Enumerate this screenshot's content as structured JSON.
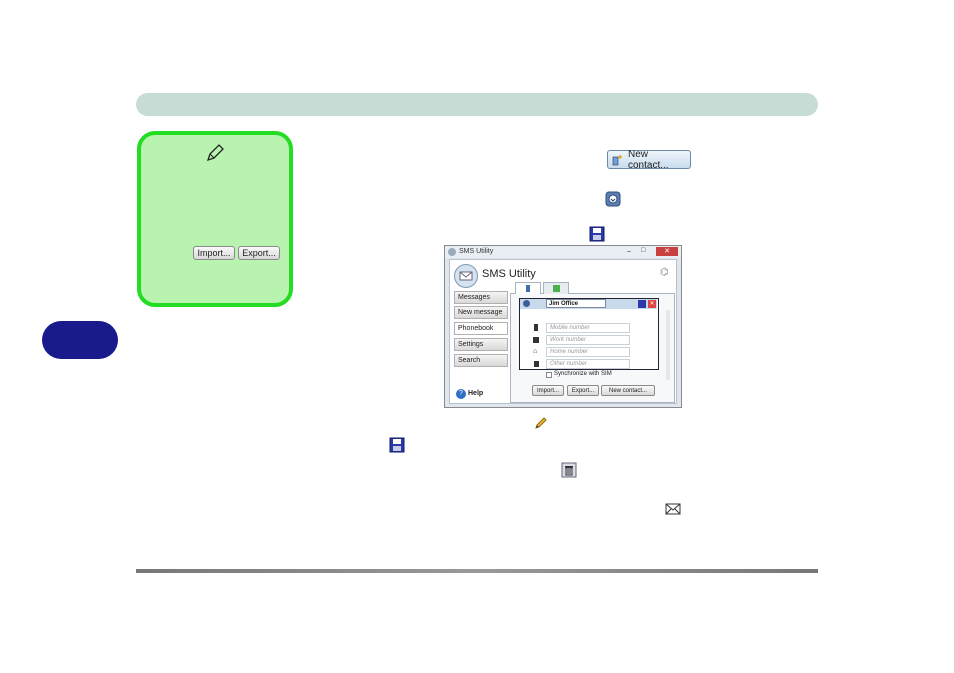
{
  "note": {
    "import_label": "Import...",
    "export_label": "Export..."
  },
  "inline_buttons": {
    "new_contact_label": "New contact..."
  },
  "sms_window": {
    "title": "SMS Utility",
    "app_name": "SMS Utility",
    "nav": [
      "Messages",
      "New message",
      "Phonebook",
      "Settings",
      "Search"
    ],
    "help_label": "Help",
    "contact_name": "Jim Office",
    "fields": [
      "Mobile number",
      "Work number",
      "Home number",
      "Other number"
    ],
    "sync_label": "Synchronize with SIM",
    "buttons": {
      "import": "Import...",
      "export": "Export...",
      "new_contact": "New contact..."
    }
  }
}
